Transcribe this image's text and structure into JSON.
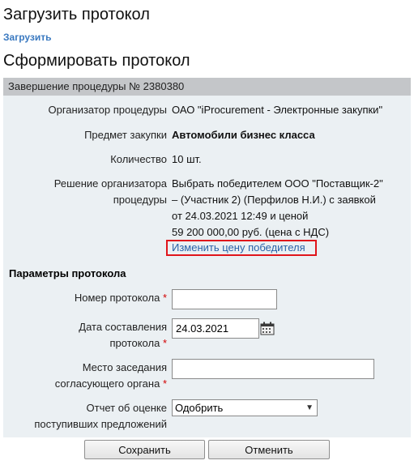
{
  "upload": {
    "title": "Загрузить протокол",
    "link": "Загрузить"
  },
  "form": {
    "title": "Сформировать протокол"
  },
  "procedure": {
    "header": "Завершение процедуры № 2380380",
    "organizer_label": "Организатор процедуры",
    "organizer_value": "ОАО \"iProcurement - Электронные закупки\"",
    "subject_label": "Предмет закупки",
    "subject_value": "Автомобили бизнес класса",
    "quantity_label": "Количество",
    "quantity_value": "10 шт.",
    "decision_label_1": "Решение организатора",
    "decision_label_2": "процедуры",
    "decision_lines": [
      "Выбрать победителем ООО \"Поставщик-2\"",
      "– (Участник 2) (Перфилов Н.И.) с заявкой",
      "от 24.03.2021 12:49 и ценой",
      "59 200 000,00 руб. (цена с НДС)"
    ],
    "change_price_link": "Изменить цену победителя"
  },
  "params": {
    "title": "Параметры протокола",
    "number_label": "Номер протокола",
    "number_value": "",
    "date_label_1": "Дата составления",
    "date_label_2": "протокола",
    "date_value": "24.03.2021",
    "place_label_1": "Место заседания",
    "place_label_2": "согласующего органа",
    "place_value": "",
    "report_label_1": "Отчет об оценке",
    "report_label_2": "поступивших предложений",
    "report_selected": "Одобрить",
    "required_mark": "*"
  },
  "buttons": {
    "save": "Сохранить",
    "cancel": "Отменить"
  },
  "colors": {
    "panel_bg": "#ebf0f3",
    "header_bg": "#c4c6c9",
    "link": "#2962a8",
    "highlight": "#e0151b",
    "required": "#d20000"
  }
}
